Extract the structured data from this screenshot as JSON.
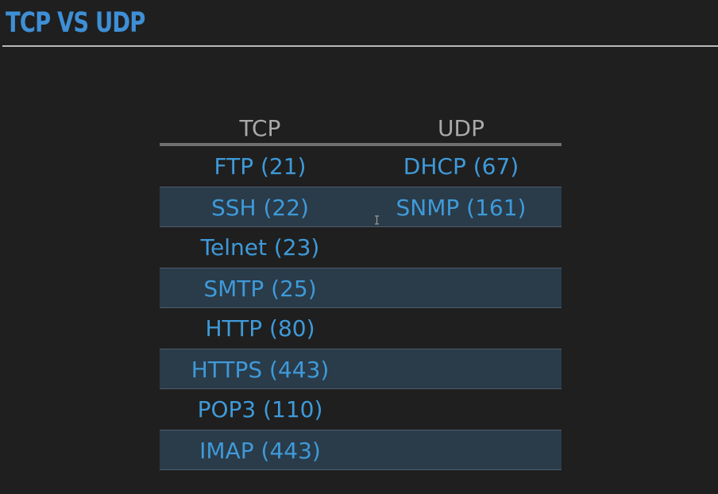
{
  "title": "TCP VS UDP",
  "table": {
    "headers": [
      "TCP",
      "UDP"
    ],
    "rows": [
      {
        "tcp": "FTP (21)",
        "udp": "DHCP (67)"
      },
      {
        "tcp": "SSH (22)",
        "udp": "SNMP (161)"
      },
      {
        "tcp": "Telnet (23)",
        "udp": ""
      },
      {
        "tcp": "SMTP (25)",
        "udp": ""
      },
      {
        "tcp": "HTTP (80)",
        "udp": ""
      },
      {
        "tcp": "HTTPS (443)",
        "udp": ""
      },
      {
        "tcp": "POP3 (110)",
        "udp": ""
      },
      {
        "tcp": "IMAP (443)",
        "udp": ""
      }
    ]
  },
  "icons": {
    "cursor": "text-cursor-icon"
  },
  "colors": {
    "background": "#1f1f1f",
    "title": "#3e8fd6",
    "header_text": "#a9a9a9",
    "cell_text": "#3e9ad9",
    "row_shade": "#2a3b49"
  }
}
